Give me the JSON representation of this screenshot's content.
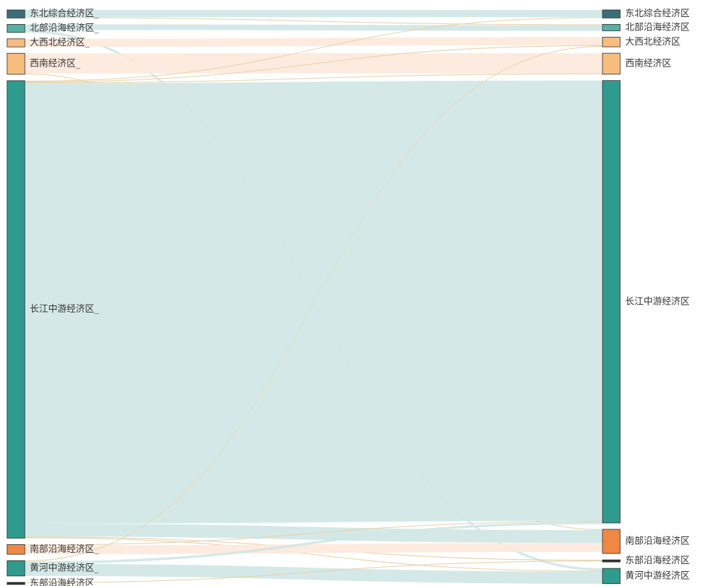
{
  "colors": {
    "teal_dark": "#3b6e78",
    "teal": "#2f9a8e",
    "teal_light": "#58b0a4",
    "orange_light": "#f6bd7f",
    "orange": "#ee8843",
    "gray_dark": "#333333",
    "flow_teal": "#cfe7e4",
    "flow_orange": "#fde9dc",
    "thin_line": "#e6cfa8"
  },
  "sankey": {
    "source_nodes": [
      {
        "label": "东北综合经济区_",
        "value": 1.0,
        "color": "#3b6e78"
      },
      {
        "label": "北部沿海经济区_",
        "value": 1.0,
        "color": "#58b0a4"
      },
      {
        "label": "大西北经济区_",
        "value": 1.0,
        "color": "#f6bd7f"
      },
      {
        "label": "西南经济区_",
        "value": 2.6,
        "color": "#f6bd7f"
      },
      {
        "label": "长江中游经济区_",
        "value": 56.6,
        "color": "#2f9a8e"
      },
      {
        "label": "南部沿海经济区_",
        "value": 1.2,
        "color": "#ee8843"
      },
      {
        "label": "黄河中游经济区_",
        "value": 1.9,
        "color": "#2f9a8e"
      },
      {
        "label": "东部沿海经济区",
        "value": 0.1,
        "color": "#333333"
      }
    ],
    "target_nodes": [
      {
        "label": "东北综合经济区",
        "value": 1.0,
        "color": "#3b6e78"
      },
      {
        "label": "北部沿海经济区",
        "value": 0.8,
        "color": "#58b0a4"
      },
      {
        "label": "大西北经济区",
        "value": 1.2,
        "color": "#f6bd7f"
      },
      {
        "label": "西南经济区",
        "value": 2.6,
        "color": "#f6bd7f"
      },
      {
        "label": "长江中游经济区",
        "value": 54.9,
        "color": "#2f9a8e"
      },
      {
        "label": "南部沿海经济区",
        "value": 3.0,
        "color": "#ee8843"
      },
      {
        "label": "东部沿海经济区",
        "value": 0.2,
        "color": "#333333"
      },
      {
        "label": "黄河中游经济区",
        "value": 1.9,
        "color": "#2f9a8e"
      }
    ],
    "links": [
      {
        "source": 0,
        "target": 0,
        "value": 0.9
      },
      {
        "source": 0,
        "target": 1,
        "value": 0.1
      },
      {
        "source": 1,
        "target": 1,
        "value": 0.7
      },
      {
        "source": 1,
        "target": 7,
        "value": 0.3
      },
      {
        "source": 2,
        "target": 2,
        "value": 1.0
      },
      {
        "source": 3,
        "target": 3,
        "value": 2.5
      },
      {
        "source": 3,
        "target": 5,
        "value": 0.1
      },
      {
        "source": 4,
        "target": 0,
        "value": 0.1
      },
      {
        "source": 4,
        "target": 2,
        "value": 0.1
      },
      {
        "source": 4,
        "target": 3,
        "value": 0.1
      },
      {
        "source": 4,
        "target": 4,
        "value": 54.5
      },
      {
        "source": 4,
        "target": 5,
        "value": 1.6
      },
      {
        "source": 4,
        "target": 6,
        "value": 0.1
      },
      {
        "source": 4,
        "target": 7,
        "value": 0.1
      },
      {
        "source": 5,
        "target": 4,
        "value": 0.1
      },
      {
        "source": 5,
        "target": 5,
        "value": 1.1
      },
      {
        "source": 6,
        "target": 2,
        "value": 0.1
      },
      {
        "source": 6,
        "target": 4,
        "value": 0.3
      },
      {
        "source": 6,
        "target": 7,
        "value": 1.5
      },
      {
        "source": 7,
        "target": 6,
        "value": 0.1
      }
    ]
  }
}
